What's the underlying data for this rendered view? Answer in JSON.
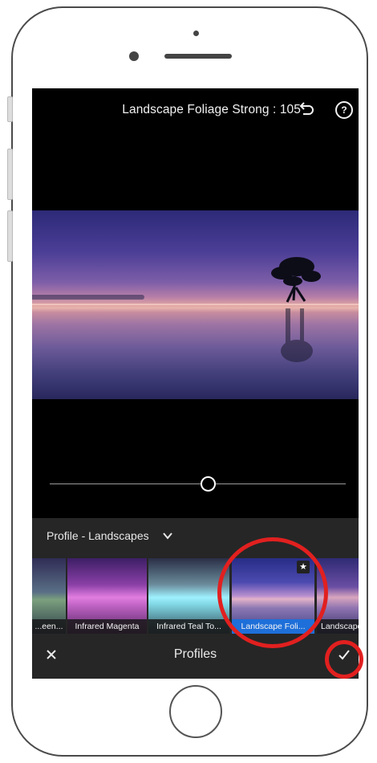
{
  "header": {
    "title": "Landscape Foliage Strong : 105",
    "undo_icon": "undo-arrow-icon",
    "help_icon": "question-circle-icon",
    "help_glyph": "?"
  },
  "slider": {
    "value": 105,
    "position_fraction": 0.55
  },
  "profile_group": {
    "label": "Profile - Landscapes",
    "icon": "chevron-down-icon"
  },
  "profiles": [
    {
      "label": "...een...",
      "selected": false
    },
    {
      "label": "Infrared Magenta",
      "selected": false
    },
    {
      "label": "Infrared Teal To...",
      "selected": false
    },
    {
      "label": "Landscape Foli...",
      "selected": true,
      "favorite": true
    },
    {
      "label": "Landscape",
      "selected": false
    }
  ],
  "footer": {
    "title": "Profiles",
    "cancel_icon": "close-icon",
    "confirm_icon": "checkmark-icon"
  },
  "favorite_glyph": "★",
  "colors": {
    "selected_label_bg": "#1e6fd9",
    "annotation_red": "#e1201f",
    "panel_bg": "#262626"
  }
}
